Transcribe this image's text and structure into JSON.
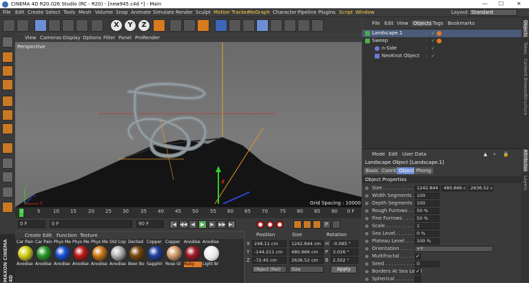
{
  "window": {
    "title": "CINEMA 4D R20.026 Studio (RC - R20) - [new945.c4d *] - Main"
  },
  "menu": [
    "File",
    "Edit",
    "Create",
    "Select",
    "Tools",
    "Mesh",
    "Volume",
    "Snap",
    "Animate",
    "Simulate",
    "Render",
    "Sculpt",
    "Motion Tracker",
    "MoGraph",
    "Character",
    "Pipeline",
    "Plugins",
    "Script",
    "Window"
  ],
  "layout": {
    "label": "Layout:",
    "value": "Standard"
  },
  "viewport": {
    "menu": [
      "View",
      "Cameras",
      "Display",
      "Options",
      "Filter",
      "Panel",
      "ProRender"
    ],
    "label": "Perspective",
    "grid_spacing": "Grid Spacing : 10000 cm",
    "axis": {
      "y": "Y",
      "x": "X",
      "z": "Z"
    }
  },
  "timeline": {
    "ticks": [
      "0",
      "5",
      "10",
      "15",
      "20",
      "25",
      "30",
      "35",
      "40",
      "45",
      "50",
      "55",
      "60",
      "65",
      "70",
      "75",
      "80",
      "85",
      "90"
    ],
    "frame_end_label": "0 F"
  },
  "playback": {
    "start": "0 F",
    "current": "0 F",
    "end": "90 F",
    "end2": "90 F"
  },
  "materials": {
    "menu": [
      "Create",
      "Edit",
      "Function",
      "Texture"
    ],
    "items": [
      {
        "name": "Car Pain",
        "label": "Anodise",
        "color": "#d8d21a"
      },
      {
        "name": "Car Pain",
        "label": "Anodise",
        "color": "#2a9a2a"
      },
      {
        "name": "Phys Me",
        "label": "Anodise",
        "color": "#1a4fd0"
      },
      {
        "name": "Phys Me",
        "label": "Anodise",
        "color": "#c01818"
      },
      {
        "name": "Phys Me",
        "label": "Anodise",
        "color": "#d07a18"
      },
      {
        "name": "Old Cop",
        "label": "Anodise",
        "color": "#b8b8b8"
      },
      {
        "name": "Dented",
        "label": "Beer Bo",
        "color": "#7a4a10"
      },
      {
        "name": "Copper",
        "label": "Sapphir",
        "color": "#2040a0"
      },
      {
        "name": "Copper",
        "label": "Rose Gl",
        "color": "#d8a070"
      },
      {
        "name": "Anodise",
        "label": "Ruby",
        "color": "#a01828"
      },
      {
        "name": "Anodise",
        "label": "Light Br",
        "color": "#e8e8e8"
      }
    ]
  },
  "coords": {
    "headers": [
      "Position",
      "Size",
      "Rotation"
    ],
    "rows": [
      {
        "axis": "X",
        "pos": "248.11 cm",
        "size": "1242.844 cm",
        "rl": "H",
        "rot": "-0.085 °"
      },
      {
        "axis": "Y",
        "pos": "-144.211 cm",
        "size": "480.666 cm",
        "rl": "P",
        "rot": "3.026 °"
      },
      {
        "axis": "Z",
        "pos": "-72.45 cm",
        "size": "2636.52 cm",
        "rl": "B",
        "rot": "2.502 °"
      }
    ],
    "mode": "Object (Rel)",
    "size_mode": "Size",
    "apply": "Apply"
  },
  "objects": {
    "tabs": [
      "File",
      "Edit",
      "View",
      "Objects",
      "Tags",
      "Bookmarks"
    ],
    "active_tab": "Objects",
    "items": [
      {
        "name": "Landscape.1",
        "selected": true
      },
      {
        "name": "Sweep",
        "selected": false
      },
      {
        "name": "n-Side",
        "selected": false
      },
      {
        "name": "NeoKnot Object",
        "selected": false
      }
    ]
  },
  "attributes": {
    "menu": [
      "Mode",
      "Edit",
      "User Data"
    ],
    "title": "Landscape Object [Landscape.1]",
    "tabs": [
      "Basic",
      "Coord.",
      "Object",
      "Phong"
    ],
    "active_tab": "Object",
    "section": "Object Properties",
    "props": [
      {
        "label": "Size . . . . . . . . . . .",
        "v1": "1242.844",
        "v2": "480.666 ci",
        "v3": "2636.52 ci"
      },
      {
        "label": "Width Segments . .",
        "v1": "100"
      },
      {
        "label": "Depth Segments . .",
        "v1": "100"
      },
      {
        "label": "Rough Furrows . . .",
        "v1": "50 %"
      },
      {
        "label": "Fine Furrows . . . .",
        "v1": "50 %"
      },
      {
        "label": "Scale . . . . . . . . . .",
        "v1": "1"
      },
      {
        "label": "Sea Level. . . . . . .",
        "v1": "0 %"
      },
      {
        "label": "Plateau Level . . . .",
        "v1": "100 %"
      },
      {
        "label": "Orientation . . . . . .",
        "v1": "+Y"
      },
      {
        "label": "Multifractal . . . . . .",
        "check": "✓"
      },
      {
        "label": "Seed . . . . . . . . . .",
        "v1": "0"
      },
      {
        "label": "Borders At Sea Level",
        "check": "✓"
      },
      {
        "label": "Spherical . . . . . . .",
        "check": ""
      }
    ]
  },
  "right_tabs": [
    "Objects",
    "Takes",
    "Content Browser",
    "Structure",
    "Attributes",
    "Layers"
  ],
  "side_logo": "MAXON CINEMA 4D"
}
